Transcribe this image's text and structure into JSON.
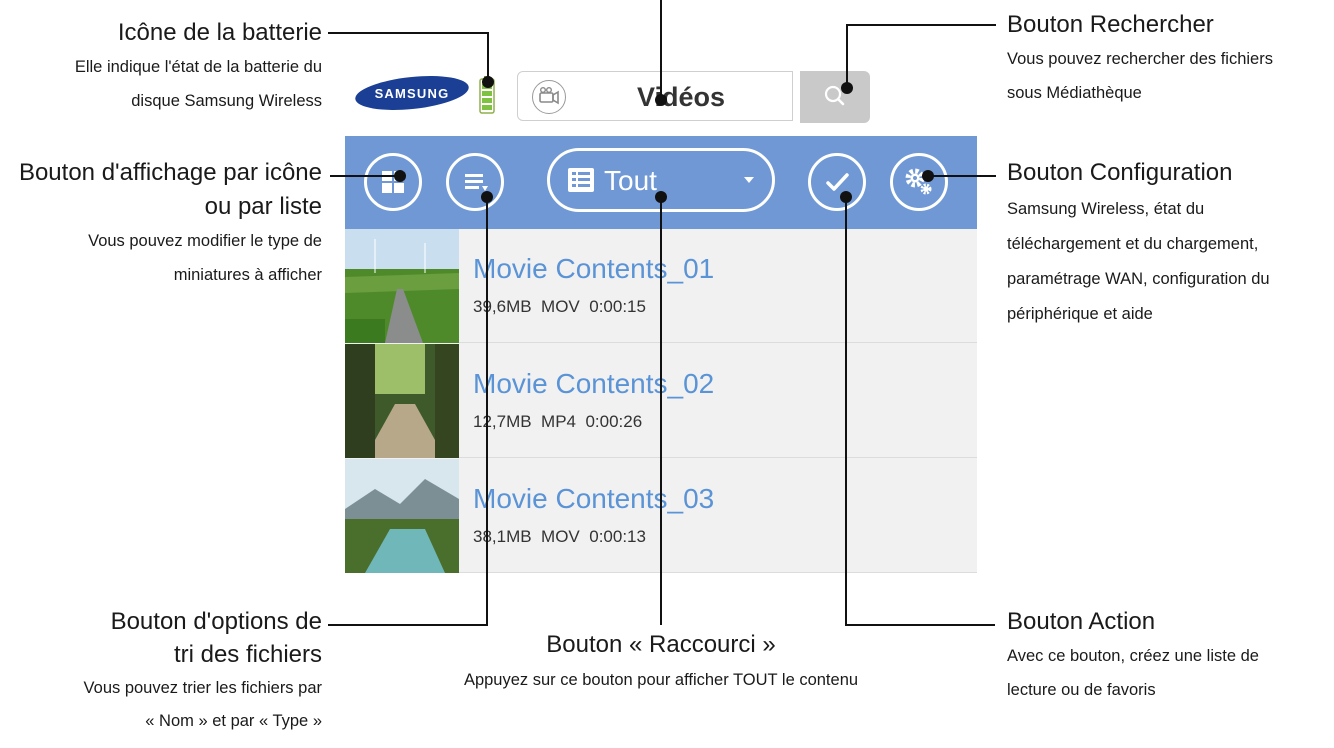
{
  "app": {
    "brand": "SAMSUNG",
    "search_title": "Vidéos",
    "filter_label": "Tout",
    "accent_color": "#6f98d4",
    "list_title_color": "#5a93d6"
  },
  "icons": {
    "category": "video-camera-icon",
    "search": "search-icon",
    "grid_view": "grid-icon",
    "sort": "sort-list-icon",
    "filter": "list-icon",
    "dropdown": "caret-down-icon",
    "action": "checkmark-icon",
    "settings": "gear-icon"
  },
  "files": [
    {
      "name": "Movie Contents_01",
      "size": "39,6MB",
      "format": "MOV",
      "duration": "0:00:15"
    },
    {
      "name": "Movie Contents_02",
      "size": "12,7MB",
      "format": "MP4",
      "duration": "0:00:26"
    },
    {
      "name": "Movie Contents_03",
      "size": "38,1MB",
      "format": "MOV",
      "duration": "0:00:13"
    }
  ],
  "annotations": {
    "battery": {
      "title": "Icône de la batterie",
      "desc1": "Elle indique l'état de la batterie du",
      "desc2": "disque Samsung Wireless"
    },
    "view": {
      "title1": "Bouton d'affichage par icône",
      "title2": "ou par liste",
      "desc1": "Vous pouvez modifier le type de",
      "desc2": "miniatures à afficher"
    },
    "sort": {
      "title1": "Bouton d'options de",
      "title2": "tri des fichiers",
      "desc1": "Vous pouvez trier les fichiers par",
      "desc2": "« Nom » et par « Type »"
    },
    "shortcut": {
      "title": "Bouton « Raccourci »",
      "desc": "Appuyez sur ce bouton pour afficher TOUT le contenu"
    },
    "search": {
      "title": "Bouton Rechercher",
      "desc1": "Vous pouvez rechercher des fichiers",
      "desc2": "sous Médiathèque"
    },
    "settings": {
      "title": "Bouton Configuration",
      "desc1": "Samsung Wireless, état du",
      "desc2": "téléchargement et du chargement,",
      "desc3": "paramétrage WAN, configuration du",
      "desc4": "périphérique et aide"
    },
    "action": {
      "title": "Bouton Action",
      "desc1": "Avec ce bouton, créez une liste de",
      "desc2": "lecture ou de favoris"
    }
  }
}
